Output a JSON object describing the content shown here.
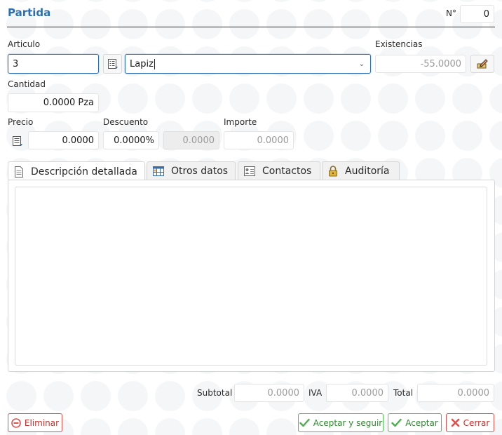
{
  "window": {
    "title": "Partida"
  },
  "numero": {
    "label": "N°",
    "value": "0"
  },
  "articulo": {
    "label": "Articulo",
    "code": "3",
    "name": "Lapiz"
  },
  "existencias": {
    "label": "Existencias",
    "value": "-55.0000"
  },
  "cantidad": {
    "label": "Cantidad",
    "value": "0.0000 Pza"
  },
  "precio": {
    "label": "Precio",
    "value": "0.0000"
  },
  "descuento": {
    "label": "Descuento",
    "percent": "0.0000%",
    "amount": "0.0000"
  },
  "importe": {
    "label": "Importe",
    "value": "0.0000"
  },
  "tabs": [
    {
      "label": "Descripción detallada",
      "icon": "document-icon",
      "active": true
    },
    {
      "label": "Otros datos",
      "icon": "table-icon",
      "active": false
    },
    {
      "label": "Contactos",
      "icon": "contact-card-icon",
      "active": false
    },
    {
      "label": "Auditoría",
      "icon": "lock-icon",
      "active": false
    }
  ],
  "totals": {
    "subtotal_label": "Subtotal",
    "subtotal": "0.0000",
    "iva_label": "IVA",
    "iva": "0.0000",
    "total_label": "Total",
    "total": "0.0000"
  },
  "buttons": {
    "delete": "Eliminar",
    "accept_continue": "Aceptar y seguir",
    "accept": "Aceptar",
    "close": "Cerrar"
  },
  "colors": {
    "title": "#2c6fb0",
    "focus": "#2f6db3",
    "danger": "#d9534f",
    "success": "#5cb85c"
  }
}
